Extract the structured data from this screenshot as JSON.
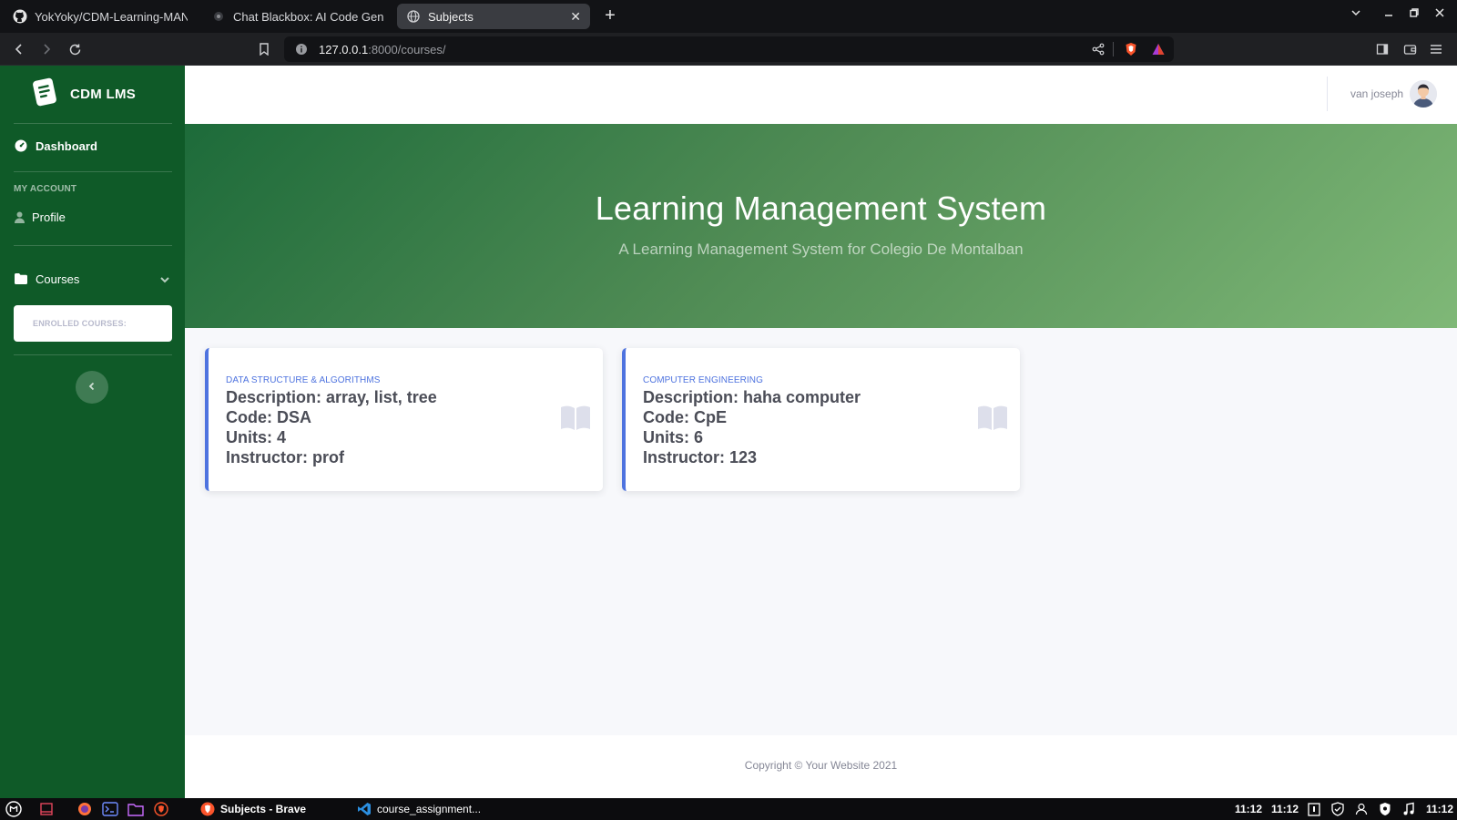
{
  "browser": {
    "tabs": [
      {
        "title": "YokYoky/CDM-Learning-MANAGE",
        "icon": "github-icon",
        "active": false
      },
      {
        "title": "Chat Blackbox: AI Code Generati",
        "icon": "blackbox-icon",
        "active": false
      },
      {
        "title": "Subjects",
        "icon": "globe-icon",
        "active": true
      }
    ],
    "new_tab": "+",
    "url_host": "127.0.0.1",
    "url_path": ":8000/courses/"
  },
  "sidebar": {
    "brand": "CDM LMS",
    "dashboard": "Dashboard",
    "account_heading": "MY ACCOUNT",
    "profile": "Profile",
    "courses": "Courses",
    "enrolled_label": "ENROLLED COURSES:"
  },
  "topnav": {
    "username": "van joseph"
  },
  "hero": {
    "title": "Learning Management System",
    "subtitle": "A Learning Management System for Colegio De Montalban"
  },
  "courses": [
    {
      "category": "DATA STRUCTURE & ALGORITHMS",
      "description": "Description: array, list, tree",
      "code": "Code: DSA",
      "units": "Units: 4",
      "instructor": "Instructor: prof"
    },
    {
      "category": "COMPUTER ENGINEERING",
      "description": "Description: haha computer",
      "code": "Code: CpE",
      "units": "Units: 6",
      "instructor": "Instructor: 123"
    }
  ],
  "footer": {
    "copyright": "Copyright © Your Website 2021"
  },
  "taskbar": {
    "task_browser": "Subjects - Brave",
    "task_editor": "course_assignment...",
    "clock_1": "11:12",
    "clock_2": "11:12",
    "clock_3": "11:12"
  },
  "colors": {
    "sidebar": "#0f5a28",
    "accent": "#4e73df",
    "hero_start": "#1d6b3a",
    "hero_end": "#7fb877"
  }
}
